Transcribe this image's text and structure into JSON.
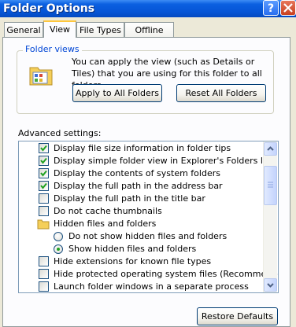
{
  "window": {
    "title": "Folder Options",
    "help_label": "?"
  },
  "tabs": [
    "General",
    "View",
    "File Types",
    "Offline Files"
  ],
  "folder_views": {
    "label": "Folder views",
    "description": "You can apply the view (such as Details or Tiles) that you are using for this folder to all folders.",
    "apply_button": "Apply to All Folders",
    "reset_button": "Reset All Folders"
  },
  "advanced": {
    "label": "Advanced settings:",
    "items": [
      {
        "type": "checkbox",
        "checked": true,
        "label": "Display file size information in folder tips"
      },
      {
        "type": "checkbox",
        "checked": true,
        "label": "Display simple folder view in Explorer's Folders list"
      },
      {
        "type": "checkbox",
        "checked": true,
        "label": "Display the contents of system folders"
      },
      {
        "type": "checkbox",
        "checked": true,
        "label": "Display the full path in the address bar"
      },
      {
        "type": "checkbox",
        "checked": false,
        "label": "Display the full path in the title bar"
      },
      {
        "type": "checkbox",
        "checked": false,
        "label": "Do not cache thumbnails"
      },
      {
        "type": "folder",
        "label": "Hidden files and folders"
      },
      {
        "type": "radio",
        "checked": false,
        "label": "Do not show hidden files and folders"
      },
      {
        "type": "radio",
        "checked": true,
        "label": "Show hidden files and folders"
      },
      {
        "type": "checkbox",
        "checked": false,
        "label": "Hide extensions for known file types"
      },
      {
        "type": "checkbox",
        "checked": false,
        "label": "Hide protected operating system files (Recommended)"
      },
      {
        "type": "checkbox",
        "checked": false,
        "label": "Launch folder windows in a separate process"
      }
    ]
  },
  "restore_button": "Restore Defaults"
}
